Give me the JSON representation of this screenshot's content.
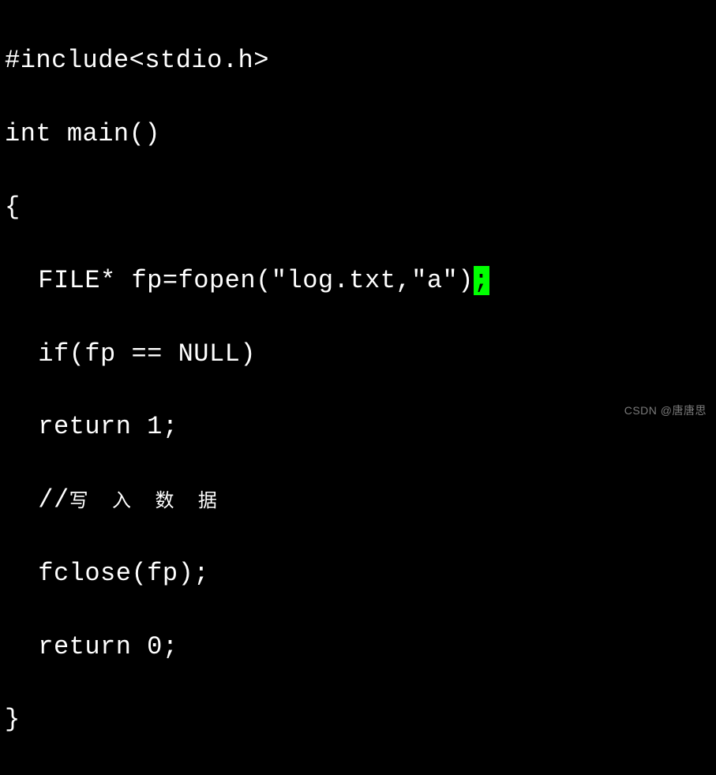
{
  "code": {
    "line1": "#include<stdio.h>",
    "line2": "int main()",
    "line3": "{",
    "line4_pre": "FILE* fp=fopen(\"log.txt,\"a\")",
    "line4_cursor": ";",
    "line5": "if(fp == NULL)",
    "line6": "return 1;",
    "line7_pre": "//",
    "line7_cjk": "写 入 数 据",
    "line8": "fclose(fp);",
    "line9": "return 0;",
    "line10": "}"
  },
  "watermark": "CSDN @唐唐思"
}
